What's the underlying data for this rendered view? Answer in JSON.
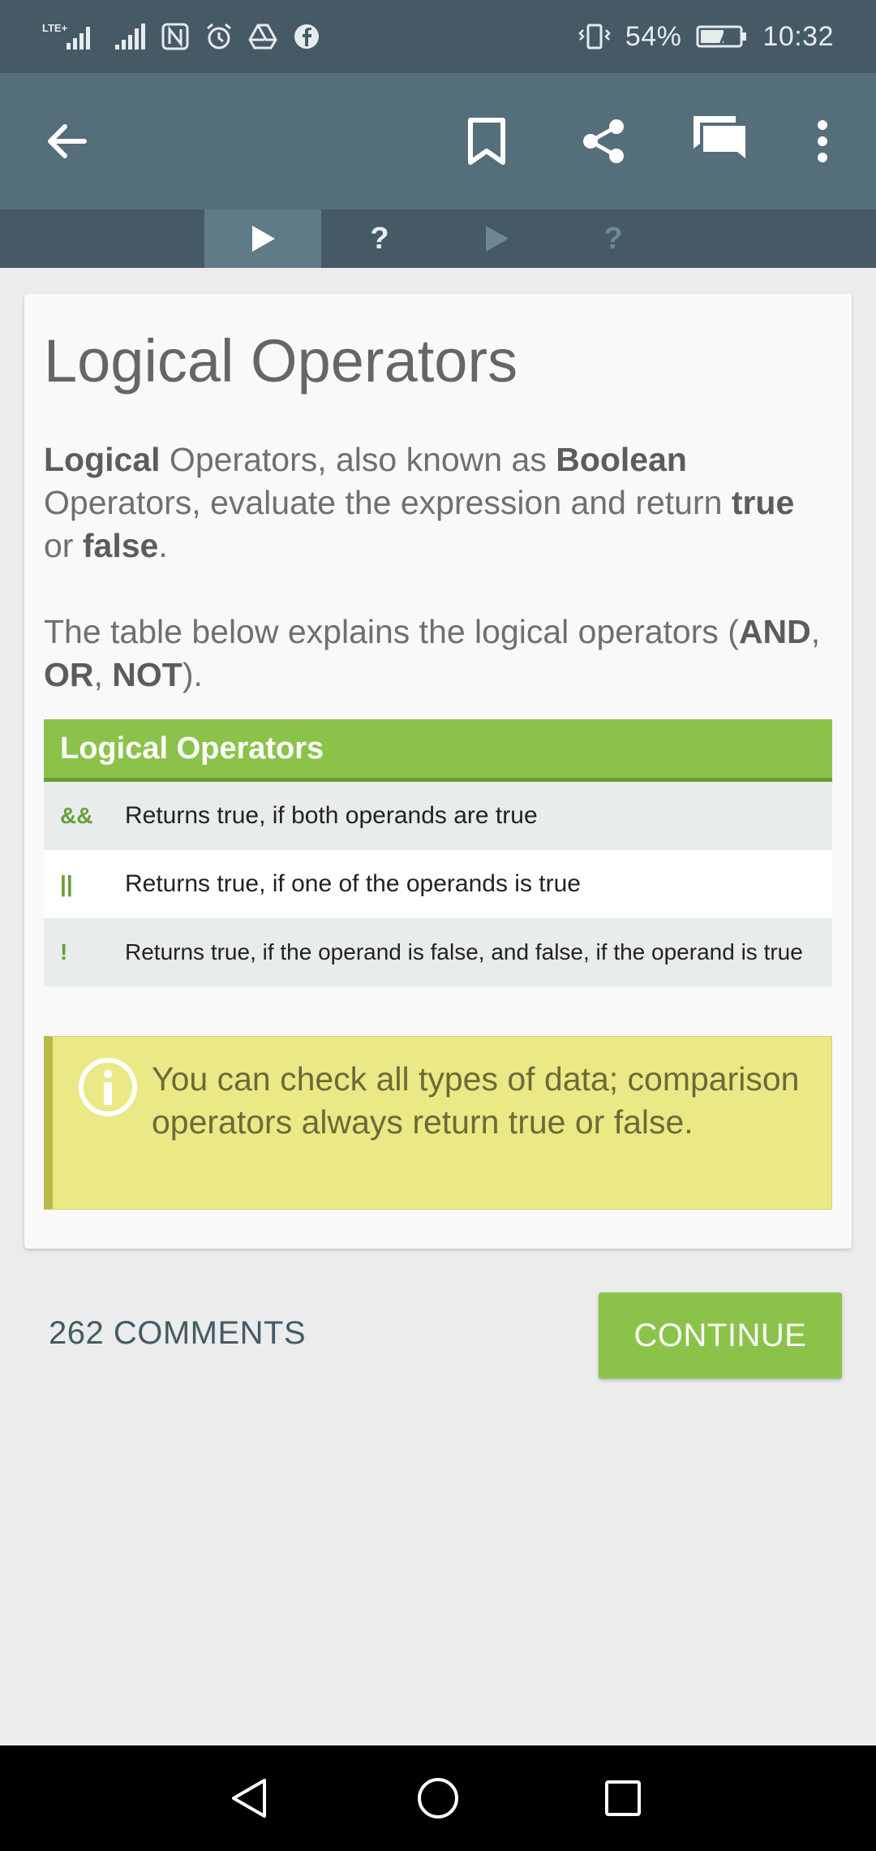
{
  "status_bar": {
    "network_left": "LTE+",
    "battery": "54%",
    "time": "10:32"
  },
  "app_bar": {
    "back_icon": "arrow-back-icon",
    "bookmark_icon": "bookmark-icon",
    "share_icon": "share-icon",
    "comments_icon": "comments-icon",
    "more_icon": "more-vert-icon"
  },
  "tabs": [
    {
      "type": "lesson",
      "icon": "play-icon",
      "active": true
    },
    {
      "type": "quiz",
      "label": "?",
      "active": false
    },
    {
      "type": "lesson",
      "icon": "play-icon",
      "active": false
    },
    {
      "type": "quiz",
      "label": "?",
      "active": false
    }
  ],
  "lesson": {
    "title": "Logical Operators",
    "intro": {
      "p1_b1": "Logical",
      "p1_t1": " Operators, also known as ",
      "p1_b2": "Boolean",
      "p1_t2": " Operators, evaluate the expression and return ",
      "p1_b3": "true",
      "p1_t3": " or ",
      "p1_b4": "false",
      "p1_t4": "."
    },
    "para2": {
      "t1": "The table below explains the logical operators (",
      "b1": "AND",
      "t2": ", ",
      "b2": "OR",
      "t3": ", ",
      "b3": "NOT",
      "t4": ")."
    },
    "table": {
      "header": "Logical Operators",
      "rows": [
        {
          "op": "&&",
          "desc": "Returns true, if both operands are true"
        },
        {
          "op": "||",
          "desc": "Returns true, if one of the operands is true"
        },
        {
          "op": "!",
          "desc": "Returns true, if the operand is false, and false, if the operand is true"
        }
      ]
    },
    "note": "You can check all types of data; comparison operators always return true or false."
  },
  "footer": {
    "comments": "262 COMMENTS",
    "continue": "CONTINUE"
  },
  "colors": {
    "status_bar": "#455a64",
    "app_bar": "#546e7a",
    "accent_green": "#8bc34a",
    "note_bg": "#ebe986"
  }
}
